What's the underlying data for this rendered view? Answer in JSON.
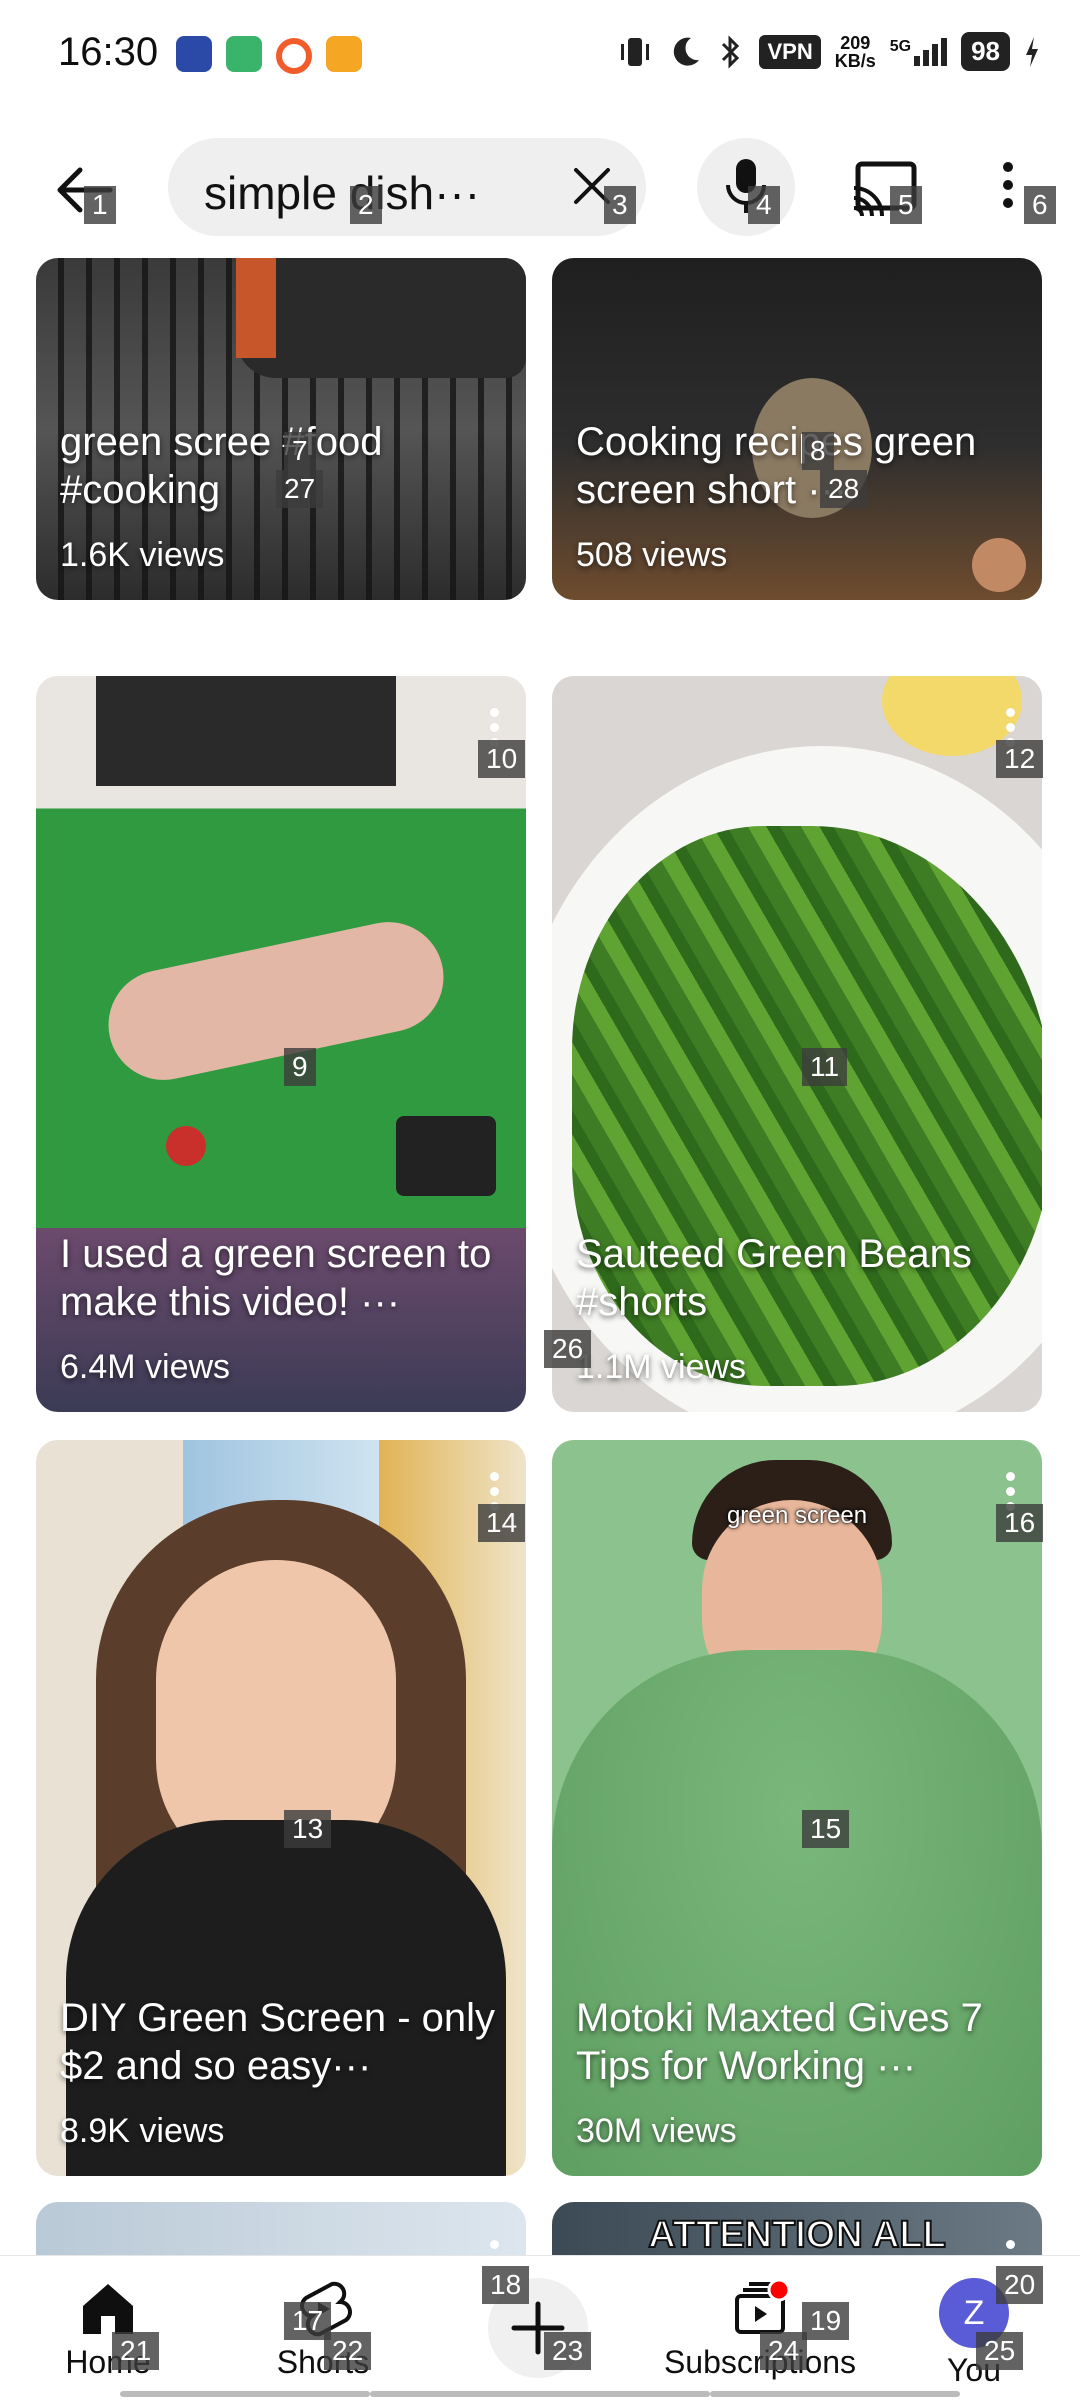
{
  "status_bar": {
    "time": "16:30",
    "vpn": "VPN",
    "speed_value": "209",
    "speed_unit": "KB/s",
    "network": "5G",
    "battery": "98"
  },
  "search": {
    "query": "simple dish···"
  },
  "cards": [
    {
      "caption": "green scree  #food #cooking",
      "views": "1.6K views"
    },
    {
      "caption": "Cooking recipes green screen short ···",
      "views": "508 views"
    },
    {
      "caption": "I used a green screen to make this video! ···",
      "views": "6.4M views"
    },
    {
      "caption": "Sauteed Green Beans #shorts",
      "views": "1.1M views"
    },
    {
      "caption": "DIY Green Screen - only $2 and so easy···",
      "views": "8.9K views"
    },
    {
      "caption": "Motoki Maxted Gives 7 Tips for Working ···",
      "views": "30M views",
      "overlay": "green screen"
    },
    {
      "caption": ""
    },
    {
      "caption": "ATTENTION ALL"
    }
  ],
  "nav": {
    "home": "Home",
    "shorts": "Shorts",
    "subscriptions": "Subscriptions",
    "you": "You",
    "avatar_letter": "Z"
  },
  "tags": [
    "1",
    "2",
    "3",
    "4",
    "5",
    "6",
    "7",
    "8",
    "9",
    "10",
    "11",
    "12",
    "13",
    "14",
    "15",
    "16",
    "17",
    "18",
    "19",
    "20",
    "21",
    "22",
    "23",
    "24",
    "25",
    "26",
    "27",
    "28"
  ],
  "colors": {
    "accent_red": "#ff0000",
    "avatar": "#5a5bd6"
  }
}
